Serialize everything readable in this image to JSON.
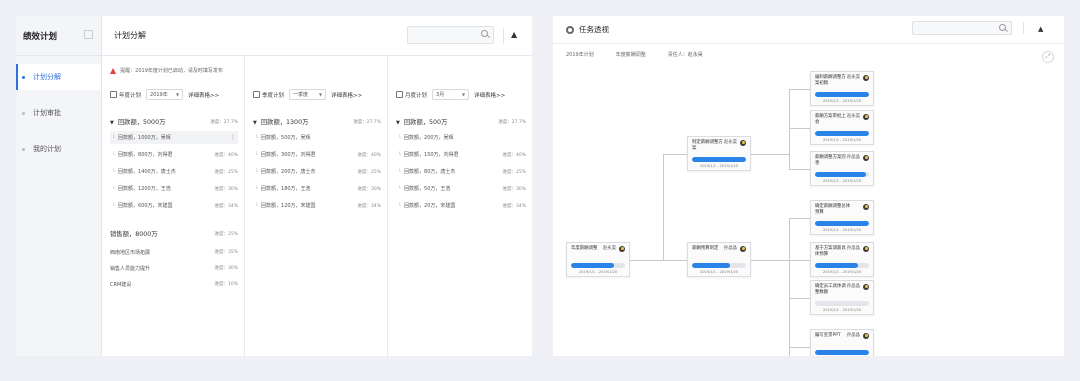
{
  "left_app": {
    "brand": "绩效计划",
    "nav": [
      {
        "label": "计划分解",
        "active": true
      },
      {
        "label": "计划审批",
        "active": false
      },
      {
        "label": "我的计划",
        "active": false
      }
    ],
    "header_title": "计划分解",
    "notice": "提醒：2019年度计划已启动，请及时填写发布",
    "columns": [
      {
        "control_label": "年度计划",
        "select_value": "2019年",
        "link": "详细表格>>",
        "group": {
          "title": "回款额，5000万",
          "progress": "进度：27.7%"
        },
        "rows": [
          {
            "name": "回款额，1000万，吴辉",
            "progress": ""
          },
          {
            "name": "回款额，800万，刘得君",
            "progress": "进度：40%"
          },
          {
            "name": "回款额，1400万，唐士杰",
            "progress": "进度：25%"
          },
          {
            "name": "回款额，1200万，王浩",
            "progress": "进度：30%"
          },
          {
            "name": "回款额，600万，宋建国",
            "progress": "进度：34%"
          }
        ],
        "extra_group": {
          "title": "销售额，8000万",
          "progress": "进度：25%"
        },
        "extra_rows": [
          {
            "name": "西南地区市场拓展",
            "progress": "进度：35%"
          },
          {
            "name": "销售人员能力提升",
            "progress": "进度：30%"
          },
          {
            "name": "CRM建设",
            "progress": "进度：10%"
          }
        ]
      },
      {
        "control_label": "季度计划",
        "select_value": "一季度",
        "link": "详细表格>>",
        "group": {
          "title": "回款额，1300万",
          "progress": "进度：27.7%"
        },
        "rows": [
          {
            "name": "回款额，500万，吴辉",
            "progress": ""
          },
          {
            "name": "回款额，300万，刘得君",
            "progress": "进度：40%"
          },
          {
            "name": "回款额，200万，唐士杰",
            "progress": "进度：25%"
          },
          {
            "name": "回款额，180万，王浩",
            "progress": "进度：30%"
          },
          {
            "name": "回款额，120万，宋建国",
            "progress": "进度：34%"
          }
        ]
      },
      {
        "control_label": "月度计划",
        "select_value": "3月",
        "link": "详细表格>>",
        "group": {
          "title": "回款额，500万",
          "progress": "进度：27.7%"
        },
        "rows": [
          {
            "name": "回款额，200万，吴辉",
            "progress": ""
          },
          {
            "name": "回款额，150万，刘得君",
            "progress": "进度：40%"
          },
          {
            "name": "回款额，80万，唐士杰",
            "progress": "进度：25%"
          },
          {
            "name": "回款额，50万，王浩",
            "progress": "进度：30%"
          },
          {
            "name": "回款额，20万，宋建国",
            "progress": "进度：34%"
          }
        ]
      }
    ]
  },
  "right_app": {
    "title": "任务透视",
    "filters": [
      "2019年计划",
      "年度薪酬调整",
      "责任人：赵永昊"
    ],
    "expand_icon": "⤢",
    "cards": [
      {
        "id": "root",
        "title": "年度薪酬调整",
        "owner": "赵永昊",
        "progress": 0.8,
        "pct": "80%",
        "date": "2019/1/1 - 2019/1/20"
      },
      {
        "id": "a",
        "title": "制定薪酬调整方案",
        "owner": "赵永昊",
        "progress": 1.0,
        "pct": "100%",
        "date": "2019/1/1 - 2019/1/20"
      },
      {
        "id": "b",
        "title": "薪酬预算制定",
        "owner": "孙晶晶",
        "progress": 0.7,
        "pct": "70%",
        "date": "2019/1/1 - 2019/1/20"
      },
      {
        "id": "a1",
        "title": "编制薪酬调整方案初稿",
        "owner": "赵永昊",
        "progress": 1.0,
        "pct": "100%",
        "date": "2019/1/1 - 2019/1/20"
      },
      {
        "id": "a2",
        "title": "薪酬方案审批上会",
        "owner": "赵永昊",
        "progress": 1.0,
        "pct": "100%",
        "date": "2019/1/1 - 2019/1/20"
      },
      {
        "id": "a3",
        "title": "薪酬调整方案完善",
        "owner": "孙晶晶",
        "progress": 0.95,
        "pct": "",
        "date": "2019/1/1 - 2019/1/20"
      },
      {
        "id": "b1",
        "title": "确定薪酬调整总体预算",
        "owner": "",
        "progress": 1.0,
        "pct": "100%",
        "date": "2019/1/1 - 2019/1/20"
      },
      {
        "id": "b2",
        "title": "基于方案调薪具体预算",
        "owner": "孙晶晶",
        "progress": 0.8,
        "pct": "80%",
        "date": "2019/1/1 - 2019/1/20"
      },
      {
        "id": "b3",
        "title": "确定员工具体调整数额",
        "owner": "孙晶晶",
        "progress": 0.0,
        "pct": "0%",
        "date": "2019/1/1 - 2019/1/20"
      },
      {
        "id": "c1",
        "title": "编写宣贯PPT",
        "owner": "孙晶晶",
        "progress": 1.0,
        "pct": "100%",
        "date": "2019/1/1 - 2019/1/20"
      }
    ]
  },
  "colors": {
    "accent": "#2a84e8",
    "active_nav": "#2f6fde",
    "warn": "#e0453a"
  }
}
